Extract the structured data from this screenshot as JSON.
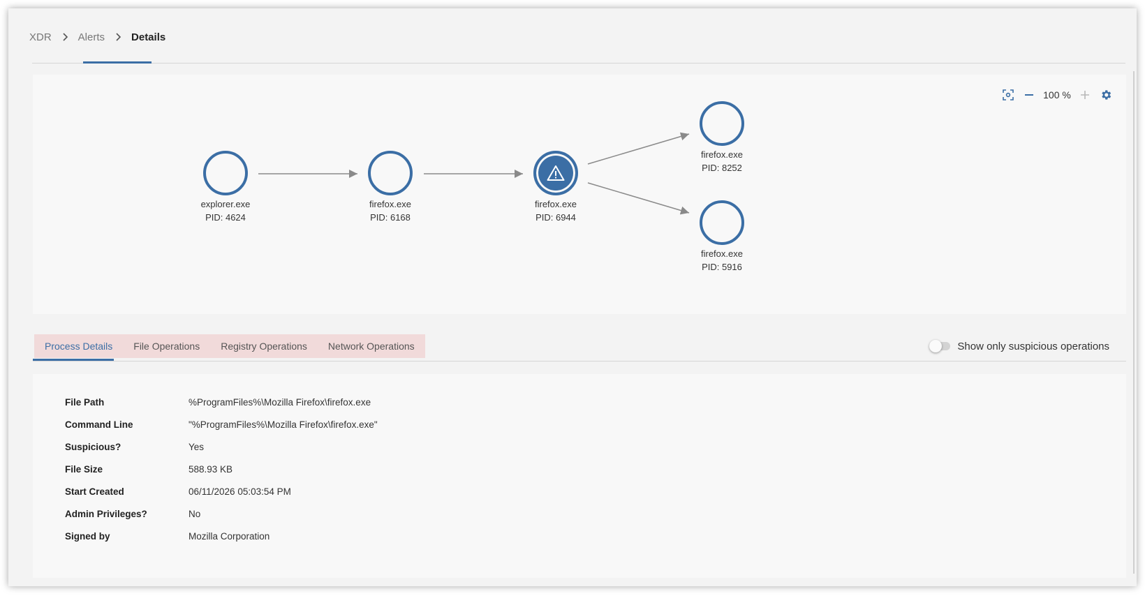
{
  "breadcrumb": {
    "items": [
      "XDR",
      "Alerts"
    ],
    "current": "Details"
  },
  "graph": {
    "zoom": "100 %",
    "toolbar_icons": [
      "fit-to-screen-icon",
      "zoom-out-icon",
      "zoom-in-icon",
      "gear-icon"
    ],
    "nodes": [
      {
        "name": "explorer.exe",
        "pid": "PID: 4624",
        "alert": false
      },
      {
        "name": "firefox.exe",
        "pid": "PID: 6168",
        "alert": false
      },
      {
        "name": "firefox.exe",
        "pid": "PID: 6944",
        "alert": true
      },
      {
        "name": "firefox.exe",
        "pid": "PID: 8252",
        "alert": false
      },
      {
        "name": "firefox.exe",
        "pid": "PID: 5916",
        "alert": false
      }
    ]
  },
  "tabs": {
    "items": [
      "Process Details",
      "File Operations",
      "Registry Operations",
      "Network Operations"
    ],
    "active": "Process Details"
  },
  "toggle": {
    "label": "Show only suspicious operations",
    "on": false
  },
  "details": {
    "rows": [
      {
        "key": "File Path",
        "value": "%ProgramFiles%\\Mozilla Firefox\\firefox.exe"
      },
      {
        "key": "Command Line",
        "value": "\"%ProgramFiles%\\Mozilla Firefox\\firefox.exe\""
      },
      {
        "key": "Suspicious?",
        "value": "Yes"
      },
      {
        "key": "File Size",
        "value": "588.93 KB"
      },
      {
        "key": "Start Created",
        "value": "06/11/2026 05:03:54 PM"
      },
      {
        "key": "Admin Privileges?",
        "value": "No"
      },
      {
        "key": "Signed by",
        "value": "Mozilla Corporation"
      }
    ]
  },
  "colors": {
    "accent": "#3b6ea5",
    "tab_highlight": "#f1dada"
  }
}
